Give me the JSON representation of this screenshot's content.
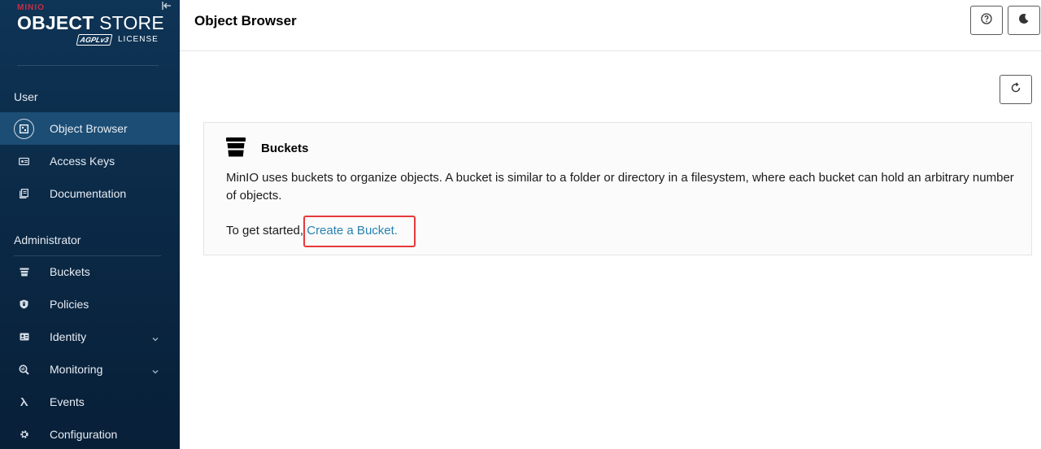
{
  "logo": {
    "brand": "MINIO",
    "title_bold": "OBJECT",
    "title_light": " STORE",
    "badge": "AGPLv3",
    "license": "LICENSE"
  },
  "sidebar": {
    "user_section": "User",
    "user_items": [
      {
        "label": "Object Browser",
        "icon": "object-browser-icon",
        "active": true
      },
      {
        "label": "Access Keys",
        "icon": "key-icon"
      },
      {
        "label": "Documentation",
        "icon": "documentation-icon"
      }
    ],
    "admin_section": "Administrator",
    "admin_items": [
      {
        "label": "Buckets",
        "icon": "bucket-icon"
      },
      {
        "label": "Policies",
        "icon": "shield-icon"
      },
      {
        "label": "Identity",
        "icon": "identity-icon",
        "expandable": true
      },
      {
        "label": "Monitoring",
        "icon": "monitoring-icon",
        "expandable": true
      },
      {
        "label": "Events",
        "icon": "lambda-icon"
      },
      {
        "label": "Configuration",
        "icon": "gear-icon"
      }
    ]
  },
  "header": {
    "title": "Object Browser"
  },
  "card": {
    "title": "Buckets",
    "description": "MinIO uses buckets to organize objects. A bucket is similar to a folder or directory in a filesystem, where each bucket can hold an arbitrary number of objects.",
    "start_prefix": "To get started, ",
    "create_link": "Create a Bucket."
  },
  "colors": {
    "sidebar_bg": "#0b2a47",
    "active_item": "#1c4d74",
    "link": "#2781b0",
    "highlight": "#e5393c",
    "brand_red": "#c72e49"
  }
}
